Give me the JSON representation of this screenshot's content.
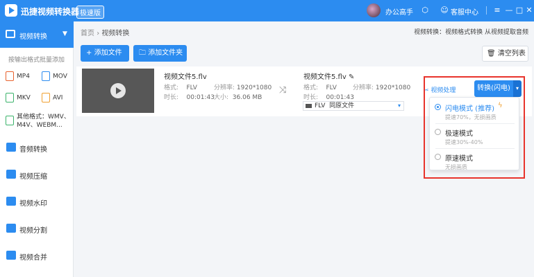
{
  "titlebar": {
    "app_name": "迅捷视频转换器",
    "edition": "极速版",
    "username": "办公高手",
    "service": "客服中心",
    "menu_icon": "≡",
    "minimize_icon": "—",
    "maximize_icon": "□",
    "close_icon": "✕"
  },
  "sidebar": {
    "active": {
      "label": "视频转换",
      "chevron": "▼"
    },
    "hint": "按输出格式批量添加",
    "formats": [
      "MP4",
      "MOV",
      "MKV",
      "AVI"
    ],
    "other_formats": {
      "line1": "其他格式：WMV、",
      "line2": "M4V、WEBM..."
    },
    "items": [
      {
        "label": "音频转换"
      },
      {
        "label": "视频压缩"
      },
      {
        "label": "视频水印"
      },
      {
        "label": "视频分割"
      },
      {
        "label": "视频合并"
      }
    ]
  },
  "main": {
    "breadcrumb": {
      "home": "首页",
      "separator": "›",
      "current": "视频转换"
    },
    "top_hint": "视频转换：视频格式转换 从视频提取音频",
    "add_file": "添加文件",
    "add_folder": "添加文件夹",
    "clear_list": "清空列表",
    "plus_icon": "+",
    "folder_icon": "🗀",
    "trash_icon": "🗑"
  },
  "file": {
    "source": {
      "name": "视频文件5.flv",
      "format_label": "格式:",
      "format": "FLV",
      "resolution_label": "分辨率:",
      "resolution": "1920*1080",
      "duration_label": "时长:",
      "duration": "00:01:43",
      "size_label": "大小:",
      "size": "36.06 MB"
    },
    "target": {
      "name": "视频文件5.flv",
      "format_label": "格式:",
      "format": "FLV",
      "resolution_label": "分辨率:",
      "resolution": "1920*1080",
      "duration_label": "时长:",
      "duration": "00:01:43",
      "select_format": "FLV",
      "select_option": "同原文件"
    },
    "shuffle_icon": "⤨",
    "edit_icon": "✎",
    "video_process": "视频处理",
    "convert_button": "转换(闪电)",
    "dropdown_icon": "▾"
  },
  "modes": [
    {
      "name": "闪电模式 (推荐)",
      "desc": "提速70%，无损画质",
      "selected": true
    },
    {
      "name": "极速模式",
      "desc": "提速30%-40%",
      "selected": false
    },
    {
      "name": "原速模式",
      "desc": "无损画质",
      "selected": false
    }
  ],
  "colors": {
    "accent": "#2c8cf0",
    "highlight": "#e8332b",
    "bolt": "#f0a030"
  }
}
